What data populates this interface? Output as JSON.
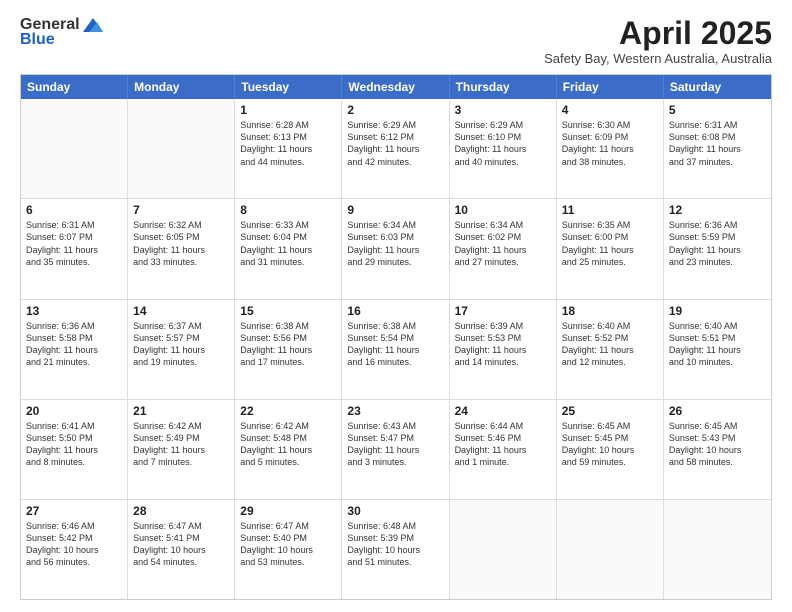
{
  "logo": {
    "general": "General",
    "blue": "Blue"
  },
  "title": "April 2025",
  "subtitle": "Safety Bay, Western Australia, Australia",
  "weekdays": [
    "Sunday",
    "Monday",
    "Tuesday",
    "Wednesday",
    "Thursday",
    "Friday",
    "Saturday"
  ],
  "weeks": [
    [
      {
        "day": "",
        "lines": []
      },
      {
        "day": "",
        "lines": []
      },
      {
        "day": "1",
        "lines": [
          "Sunrise: 6:28 AM",
          "Sunset: 6:13 PM",
          "Daylight: 11 hours",
          "and 44 minutes."
        ]
      },
      {
        "day": "2",
        "lines": [
          "Sunrise: 6:29 AM",
          "Sunset: 6:12 PM",
          "Daylight: 11 hours",
          "and 42 minutes."
        ]
      },
      {
        "day": "3",
        "lines": [
          "Sunrise: 6:29 AM",
          "Sunset: 6:10 PM",
          "Daylight: 11 hours",
          "and 40 minutes."
        ]
      },
      {
        "day": "4",
        "lines": [
          "Sunrise: 6:30 AM",
          "Sunset: 6:09 PM",
          "Daylight: 11 hours",
          "and 38 minutes."
        ]
      },
      {
        "day": "5",
        "lines": [
          "Sunrise: 6:31 AM",
          "Sunset: 6:08 PM",
          "Daylight: 11 hours",
          "and 37 minutes."
        ]
      }
    ],
    [
      {
        "day": "6",
        "lines": [
          "Sunrise: 6:31 AM",
          "Sunset: 6:07 PM",
          "Daylight: 11 hours",
          "and 35 minutes."
        ]
      },
      {
        "day": "7",
        "lines": [
          "Sunrise: 6:32 AM",
          "Sunset: 6:05 PM",
          "Daylight: 11 hours",
          "and 33 minutes."
        ]
      },
      {
        "day": "8",
        "lines": [
          "Sunrise: 6:33 AM",
          "Sunset: 6:04 PM",
          "Daylight: 11 hours",
          "and 31 minutes."
        ]
      },
      {
        "day": "9",
        "lines": [
          "Sunrise: 6:34 AM",
          "Sunset: 6:03 PM",
          "Daylight: 11 hours",
          "and 29 minutes."
        ]
      },
      {
        "day": "10",
        "lines": [
          "Sunrise: 6:34 AM",
          "Sunset: 6:02 PM",
          "Daylight: 11 hours",
          "and 27 minutes."
        ]
      },
      {
        "day": "11",
        "lines": [
          "Sunrise: 6:35 AM",
          "Sunset: 6:00 PM",
          "Daylight: 11 hours",
          "and 25 minutes."
        ]
      },
      {
        "day": "12",
        "lines": [
          "Sunrise: 6:36 AM",
          "Sunset: 5:59 PM",
          "Daylight: 11 hours",
          "and 23 minutes."
        ]
      }
    ],
    [
      {
        "day": "13",
        "lines": [
          "Sunrise: 6:36 AM",
          "Sunset: 5:58 PM",
          "Daylight: 11 hours",
          "and 21 minutes."
        ]
      },
      {
        "day": "14",
        "lines": [
          "Sunrise: 6:37 AM",
          "Sunset: 5:57 PM",
          "Daylight: 11 hours",
          "and 19 minutes."
        ]
      },
      {
        "day": "15",
        "lines": [
          "Sunrise: 6:38 AM",
          "Sunset: 5:56 PM",
          "Daylight: 11 hours",
          "and 17 minutes."
        ]
      },
      {
        "day": "16",
        "lines": [
          "Sunrise: 6:38 AM",
          "Sunset: 5:54 PM",
          "Daylight: 11 hours",
          "and 16 minutes."
        ]
      },
      {
        "day": "17",
        "lines": [
          "Sunrise: 6:39 AM",
          "Sunset: 5:53 PM",
          "Daylight: 11 hours",
          "and 14 minutes."
        ]
      },
      {
        "day": "18",
        "lines": [
          "Sunrise: 6:40 AM",
          "Sunset: 5:52 PM",
          "Daylight: 11 hours",
          "and 12 minutes."
        ]
      },
      {
        "day": "19",
        "lines": [
          "Sunrise: 6:40 AM",
          "Sunset: 5:51 PM",
          "Daylight: 11 hours",
          "and 10 minutes."
        ]
      }
    ],
    [
      {
        "day": "20",
        "lines": [
          "Sunrise: 6:41 AM",
          "Sunset: 5:50 PM",
          "Daylight: 11 hours",
          "and 8 minutes."
        ]
      },
      {
        "day": "21",
        "lines": [
          "Sunrise: 6:42 AM",
          "Sunset: 5:49 PM",
          "Daylight: 11 hours",
          "and 7 minutes."
        ]
      },
      {
        "day": "22",
        "lines": [
          "Sunrise: 6:42 AM",
          "Sunset: 5:48 PM",
          "Daylight: 11 hours",
          "and 5 minutes."
        ]
      },
      {
        "day": "23",
        "lines": [
          "Sunrise: 6:43 AM",
          "Sunset: 5:47 PM",
          "Daylight: 11 hours",
          "and 3 minutes."
        ]
      },
      {
        "day": "24",
        "lines": [
          "Sunrise: 6:44 AM",
          "Sunset: 5:46 PM",
          "Daylight: 11 hours",
          "and 1 minute."
        ]
      },
      {
        "day": "25",
        "lines": [
          "Sunrise: 6:45 AM",
          "Sunset: 5:45 PM",
          "Daylight: 10 hours",
          "and 59 minutes."
        ]
      },
      {
        "day": "26",
        "lines": [
          "Sunrise: 6:45 AM",
          "Sunset: 5:43 PM",
          "Daylight: 10 hours",
          "and 58 minutes."
        ]
      }
    ],
    [
      {
        "day": "27",
        "lines": [
          "Sunrise: 6:46 AM",
          "Sunset: 5:42 PM",
          "Daylight: 10 hours",
          "and 56 minutes."
        ]
      },
      {
        "day": "28",
        "lines": [
          "Sunrise: 6:47 AM",
          "Sunset: 5:41 PM",
          "Daylight: 10 hours",
          "and 54 minutes."
        ]
      },
      {
        "day": "29",
        "lines": [
          "Sunrise: 6:47 AM",
          "Sunset: 5:40 PM",
          "Daylight: 10 hours",
          "and 53 minutes."
        ]
      },
      {
        "day": "30",
        "lines": [
          "Sunrise: 6:48 AM",
          "Sunset: 5:39 PM",
          "Daylight: 10 hours",
          "and 51 minutes."
        ]
      },
      {
        "day": "",
        "lines": []
      },
      {
        "day": "",
        "lines": []
      },
      {
        "day": "",
        "lines": []
      }
    ]
  ]
}
